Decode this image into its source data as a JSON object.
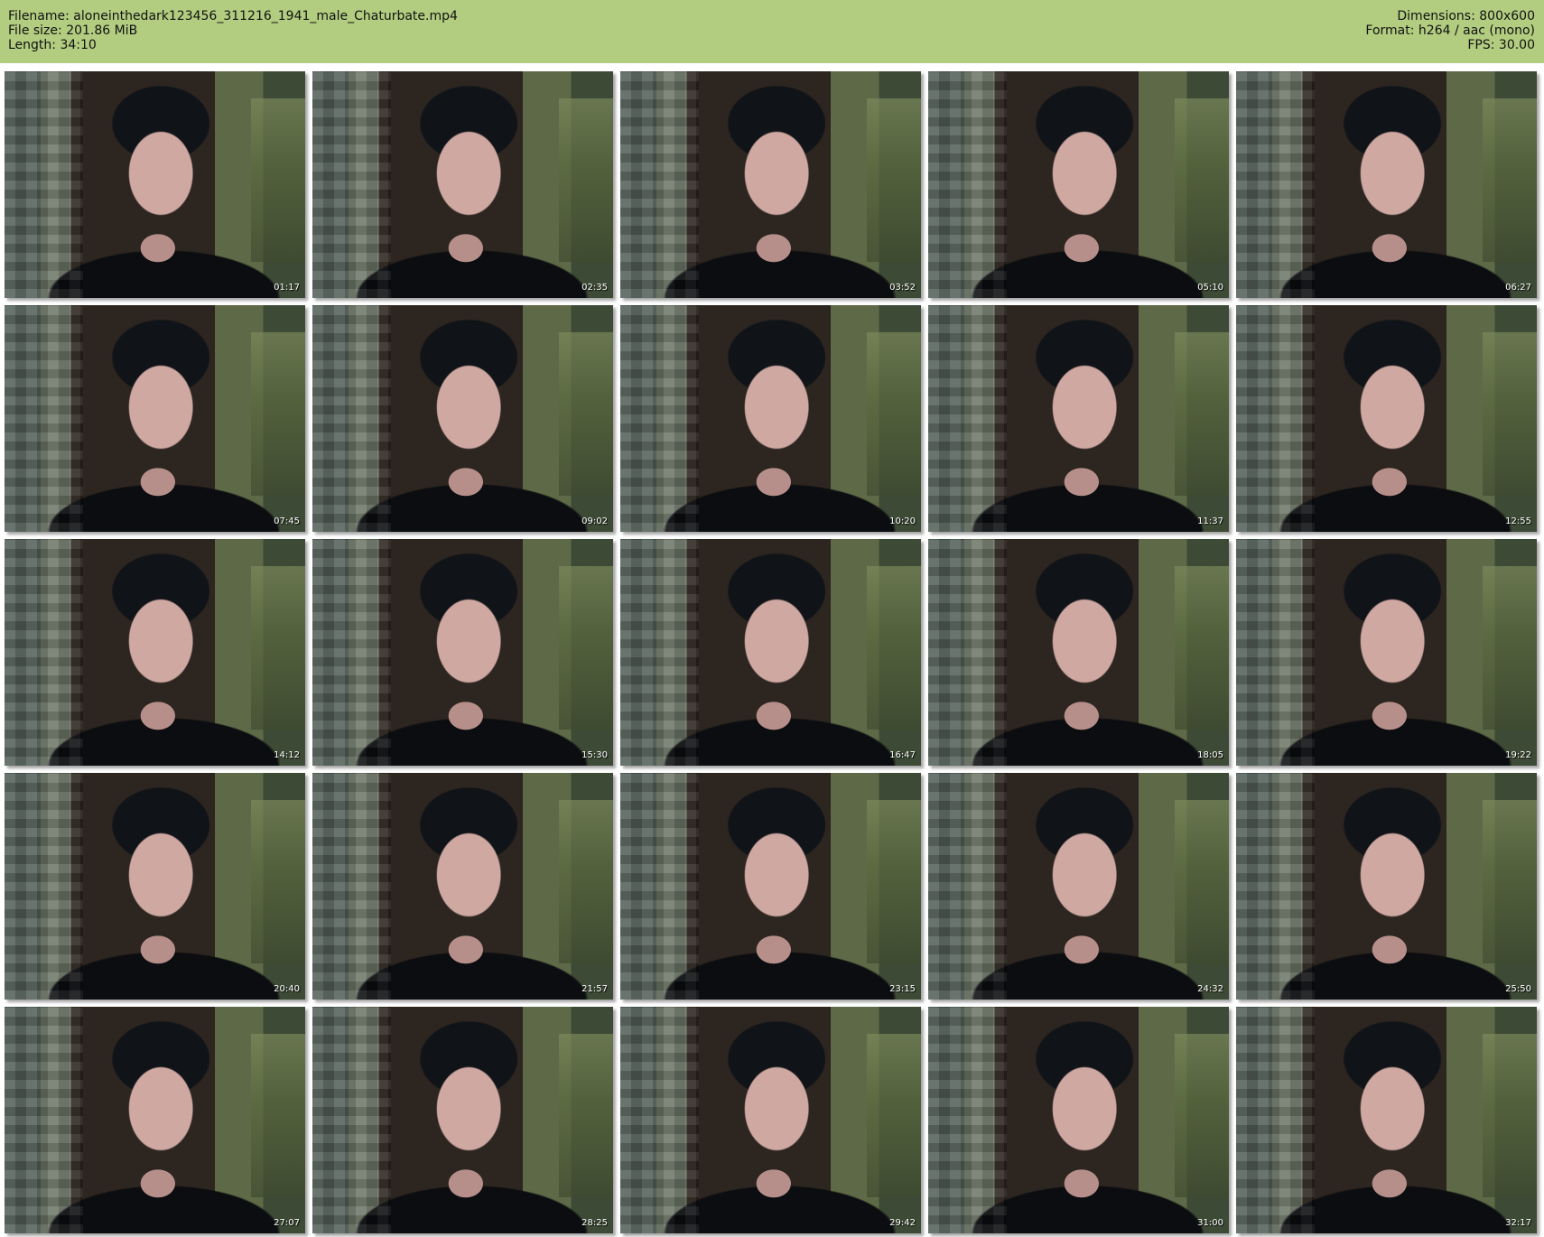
{
  "header": {
    "filename": "Filename: aloneinthedark123456_311216_1941_male_Chaturbate.mp4",
    "filesize": "File size: 201.86 MiB",
    "length": "Length: 34:10",
    "dimensions": "Dimensions: 800x600",
    "format": "Format: h264 / aac (mono)",
    "fps": "FPS: 30.00"
  },
  "thumbnails": [
    {
      "time": "01:17"
    },
    {
      "time": "02:35"
    },
    {
      "time": "03:52"
    },
    {
      "time": "05:10"
    },
    {
      "time": "06:27"
    },
    {
      "time": "07:45"
    },
    {
      "time": "09:02"
    },
    {
      "time": "10:20"
    },
    {
      "time": "11:37"
    },
    {
      "time": "12:55"
    },
    {
      "time": "14:12"
    },
    {
      "time": "15:30"
    },
    {
      "time": "16:47"
    },
    {
      "time": "18:05"
    },
    {
      "time": "19:22"
    },
    {
      "time": "20:40"
    },
    {
      "time": "21:57"
    },
    {
      "time": "23:15"
    },
    {
      "time": "24:32"
    },
    {
      "time": "25:50"
    },
    {
      "time": "27:07"
    },
    {
      "time": "28:25"
    },
    {
      "time": "29:42"
    },
    {
      "time": "31:00"
    },
    {
      "time": "32:17"
    }
  ],
  "colors": {
    "header_bg": "#b2cd80"
  }
}
